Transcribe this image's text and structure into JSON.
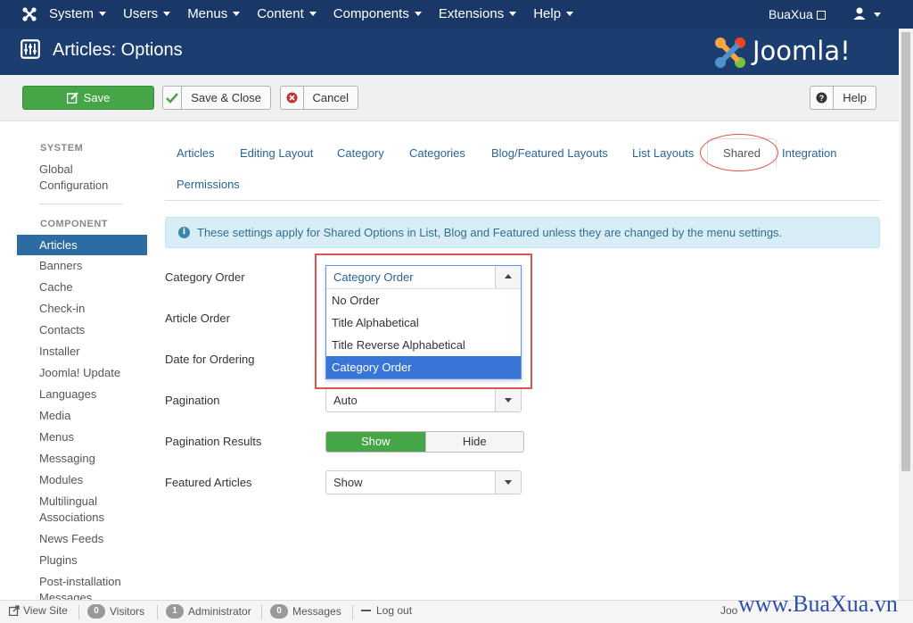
{
  "navbar": {
    "menu": [
      "System",
      "Users",
      "Menus",
      "Content",
      "Components",
      "Extensions",
      "Help"
    ],
    "user_site": "BuaXua"
  },
  "header": {
    "title": "Articles: Options",
    "brand": "Joomla!"
  },
  "toolbar": {
    "save": "Save",
    "save_close": "Save & Close",
    "cancel": "Cancel",
    "help": "Help"
  },
  "sidebar": {
    "system_heading": "SYSTEM",
    "global_config": [
      "Global",
      "Configuration"
    ],
    "component_heading": "COMPONENT",
    "active": "Articles",
    "items": [
      "Banners",
      "Cache",
      "Check-in",
      "Contacts",
      "Installer",
      "Joomla! Update",
      "Languages",
      "Media",
      "Menus",
      "Messaging",
      "Modules"
    ],
    "multilingual": [
      "Multilingual",
      "Associations"
    ],
    "items2": [
      "News Feeds",
      "Plugins"
    ],
    "post_install": [
      "Post-installation",
      "Messages"
    ]
  },
  "tabs": {
    "items": [
      "Articles",
      "Editing Layout",
      "Category",
      "Categories",
      "Blog/Featured Layouts",
      "List Layouts",
      "Shared",
      "Integration",
      "Permissions"
    ],
    "active_index": 6
  },
  "alert": {
    "text": "These settings apply for Shared Options in List, Blog and Featured unless they are changed by the menu settings."
  },
  "form": {
    "category_order_label": "Category Order",
    "category_order_value": "Category Order",
    "category_order_options": [
      "No Order",
      "Title Alphabetical",
      "Title Reverse Alphabetical",
      "Category Order"
    ],
    "category_order_selected_index": 3,
    "article_order_label": "Article Order",
    "date_ordering_label": "Date for Ordering",
    "pagination_label": "Pagination",
    "pagination_value": "Auto",
    "pagination_results_label": "Pagination Results",
    "pagination_results_on": "Show",
    "pagination_results_off": "Hide",
    "featured_label": "Featured Articles",
    "featured_value": "Show"
  },
  "footer": {
    "view_site": "View Site",
    "visitors_count": "0",
    "visitors": "Visitors",
    "admin_count": "1",
    "admin": "Administrator",
    "messages_count": "0",
    "messages": "Messages",
    "logout": "Log out",
    "joomla_partial": "Joo",
    "watermark": "www.BuaXua.vn"
  },
  "colors": {
    "navbar": "#1a3867",
    "header": "#1c3d6f",
    "save": "#46a546",
    "active_blue": "#2d6ca2",
    "highlight": "#d9534f"
  }
}
